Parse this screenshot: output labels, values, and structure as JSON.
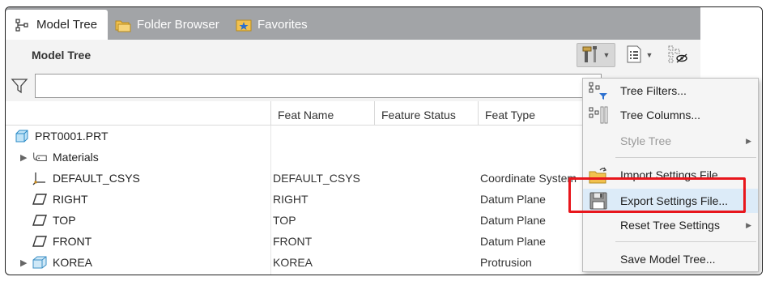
{
  "tabs": [
    {
      "label": "Model Tree",
      "icon": "model-tree-icon",
      "active": true
    },
    {
      "label": "Folder Browser",
      "icon": "folder-browser-icon",
      "active": false
    },
    {
      "label": "Favorites",
      "icon": "favorites-icon",
      "active": false
    }
  ],
  "header": {
    "title": "Model Tree"
  },
  "filter": {
    "value": "",
    "placeholder": ""
  },
  "columns": [
    "Feat Name",
    "Feature Status",
    "Feat Type"
  ],
  "rows": [
    {
      "name": "PRT0001.PRT",
      "icon": "part-icon",
      "expandable": false,
      "feat_name": "",
      "status": "",
      "type": ""
    },
    {
      "name": "Materials",
      "icon": "materials-icon",
      "expandable": true,
      "feat_name": "",
      "status": "",
      "type": ""
    },
    {
      "name": "DEFAULT_CSYS",
      "icon": "csys-icon",
      "expandable": false,
      "feat_name": "DEFAULT_CSYS",
      "status": "",
      "type": "Coordinate System"
    },
    {
      "name": "RIGHT",
      "icon": "datum-plane-icon",
      "expandable": false,
      "feat_name": "RIGHT",
      "status": "",
      "type": "Datum Plane"
    },
    {
      "name": "TOP",
      "icon": "datum-plane-icon",
      "expandable": false,
      "feat_name": "TOP",
      "status": "",
      "type": "Datum Plane"
    },
    {
      "name": "FRONT",
      "icon": "datum-plane-icon",
      "expandable": false,
      "feat_name": "FRONT",
      "status": "",
      "type": "Datum Plane"
    },
    {
      "name": "KOREA",
      "icon": "protrusion-icon",
      "expandable": true,
      "feat_name": "KOREA",
      "status": "",
      "type": "Protrusion"
    }
  ],
  "menu": {
    "items": [
      {
        "label": "Tree Filters...",
        "icon": "tree-filters-icon",
        "disabled": false,
        "submenu": false
      },
      {
        "label": "Tree Columns...",
        "icon": "tree-columns-icon",
        "disabled": false,
        "submenu": false
      },
      {
        "label": "Style Tree",
        "icon": "",
        "disabled": true,
        "submenu": true
      },
      {
        "label": "Import Settings File",
        "icon": "import-settings-icon",
        "disabled": false,
        "submenu": false
      },
      {
        "label": "Export Settings File...",
        "icon": "export-settings-icon",
        "disabled": false,
        "submenu": false
      },
      {
        "label": "Reset Tree Settings",
        "icon": "",
        "disabled": false,
        "submenu": true
      },
      {
        "label": "Save Model Tree...",
        "icon": "",
        "disabled": false,
        "submenu": false
      }
    ]
  },
  "colors": {
    "highlight": "#e8161c",
    "tabbar": "#a2a4a7",
    "menu_hover": "#dcebf8"
  }
}
